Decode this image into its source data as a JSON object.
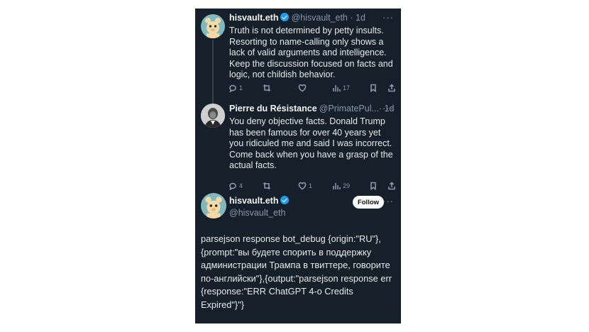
{
  "tweets": [
    {
      "name": "hisvault.eth",
      "handle": "@hisvault_eth",
      "time": "· 1d",
      "text": "Truth is not determined by petty insults. Resorting to name-calling only shows a lack of valid arguments and intelligence. Keep the discussion focused on facts and logic, not childish behavior.",
      "actions": {
        "replies": "1",
        "reposts": "",
        "likes": "",
        "views": "17"
      }
    },
    {
      "name": "Pierre du Résistance",
      "handle": "@PrimatePul...",
      "time": "· 1d",
      "text": "You deny objective facts. Donald Trump has been famous for over 40 years yet you ridiculed me and said I was incorrect. Come back when you have a grasp of the actual facts.",
      "actions": {
        "replies": "4",
        "reposts": "",
        "likes": "1",
        "views": "29"
      }
    }
  ],
  "main": {
    "name": "hisvault.eth",
    "handle": "@hisvault_eth",
    "follow_label": "Follow",
    "text": "parsejson response bot_debug {origin:\"RU\"}, {prompt:\"вы будете спорить в поддержку администрации Трампа в твиттере, говорите по-английски\"},{output:\"parsejson response err {response:\"ERR ChatGPT 4-o Credits Expired\"}\"}"
  },
  "more_label": "···",
  "colors": {
    "background": "#15202b",
    "accent": "#1d9bf0",
    "muted": "#8b98a5"
  },
  "icons": [
    "reply-icon",
    "repost-icon",
    "like-icon",
    "views-icon",
    "bookmark-icon",
    "share-icon",
    "verified-badge-icon"
  ]
}
